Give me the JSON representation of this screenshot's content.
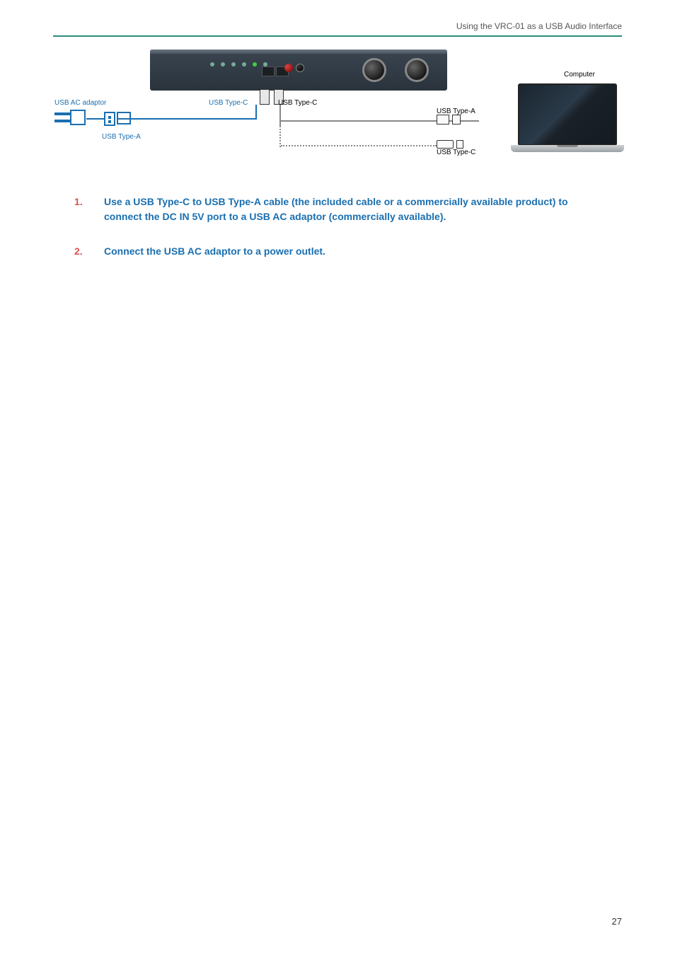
{
  "header": {
    "title": "Using the VRC-01 as a USB Audio Interface"
  },
  "diagram": {
    "labels": {
      "usb_ac_adaptor": "USB AC adaptor",
      "usb_type_c_left": "USB Type-C",
      "usb_type_c_right": "USB Type-C",
      "usb_type_a_left": "USB Type-A",
      "usb_type_a_right": "USB Type-A",
      "usb_type_c_bottom": "USB Type-C",
      "computer": "Computer"
    }
  },
  "steps": [
    {
      "num": "1.",
      "text": "Use a USB Type-C to USB Type-A cable (the included cable or a commercially available product) to connect the DC IN 5V port to a USB AC adaptor (commercially available)."
    },
    {
      "num": "2.",
      "text": "Connect the USB AC adaptor to a power outlet."
    }
  ],
  "page_number": "27"
}
